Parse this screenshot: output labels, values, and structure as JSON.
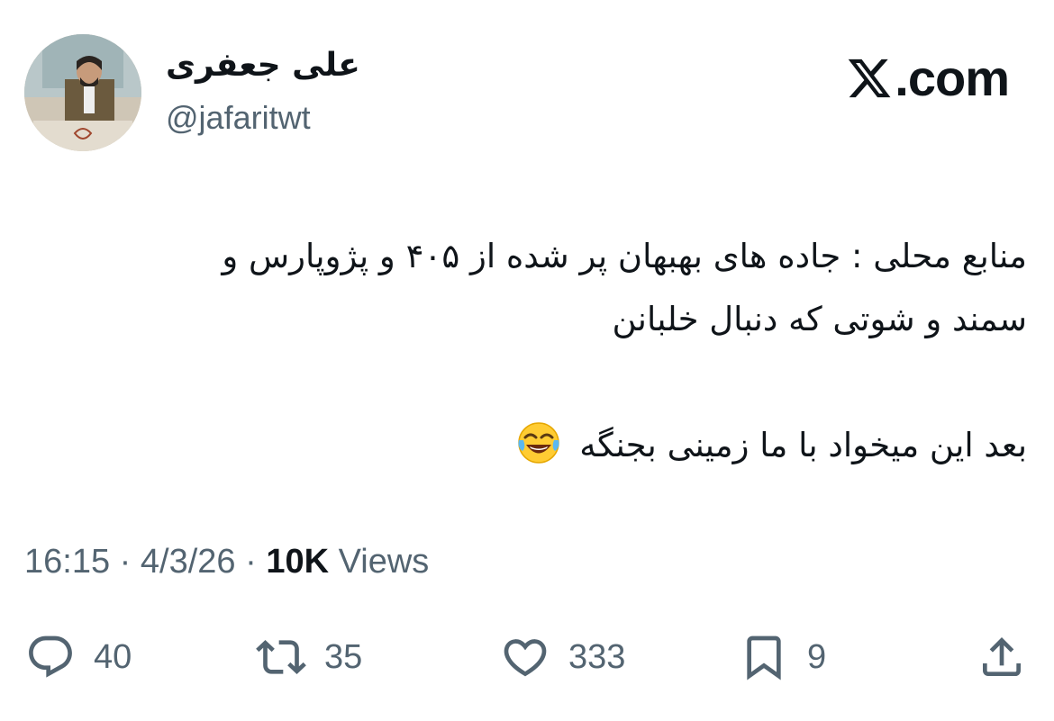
{
  "author": {
    "display_name": "علی جعفری",
    "handle": "@jafaritwt"
  },
  "brand": {
    "label": ".com",
    "icon": "x-logo-icon"
  },
  "tweet": {
    "lines": [
      "منابع محلی : جاده های بهبهان پر شده از ۴۰۵ و پژوپارس و",
      "سمند و شوتی که دنبال خلبانن",
      "بعد این میخواد با ما زمینی بجنگه"
    ],
    "emoji": "face-with-tears-of-joy-icon"
  },
  "meta": {
    "time": "16:15",
    "separator": "·",
    "date": "4/3/26",
    "views_count": "10K",
    "views_label": "Views"
  },
  "actions": {
    "replies": "40",
    "reposts": "35",
    "likes": "333",
    "bookmarks": "9"
  },
  "colors": {
    "text": "#0f1419",
    "secondary": "#536471",
    "background": "#ffffff"
  }
}
